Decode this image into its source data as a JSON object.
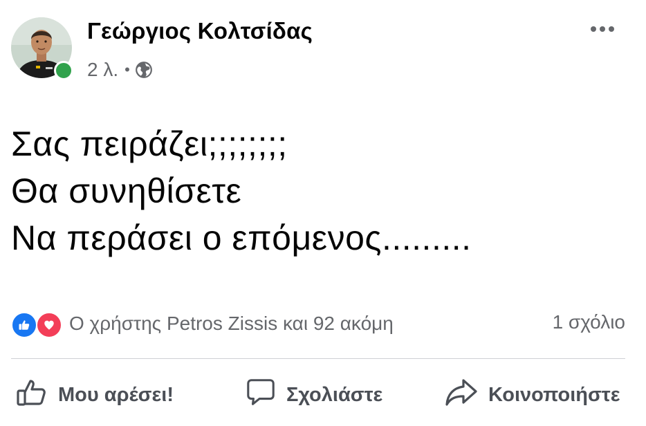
{
  "post": {
    "author": {
      "name": "Γεώργιος Κολτσίδας",
      "online": true,
      "online_color": "#31a24c"
    },
    "meta": {
      "time": "2 λ.",
      "separator": "•",
      "privacy_icon": "globe-icon"
    },
    "more_icon": "more-horizontal-icon",
    "text_lines": [
      "Σας πειράζει;;;;;;;;",
      "Θα συνηθίσετε",
      "Να περάσει ο επόμενος........."
    ],
    "reactions": {
      "icons": [
        "like-reaction-icon",
        "love-reaction-icon"
      ],
      "summary": "Ο χρήστης Petros Zissis και 92 ακόμη",
      "like_color": "#1877f2",
      "love_color": "#f33e58"
    },
    "comments_count": "1 σχόλιο",
    "actions": {
      "like_label": "Μου αρέσει!",
      "like_icon": "thumbs-up-icon",
      "comment_label": "Σχολιάστε",
      "comment_icon": "comment-bubble-icon",
      "share_label": "Κοινοποιήστε",
      "share_icon": "share-arrow-icon"
    }
  }
}
